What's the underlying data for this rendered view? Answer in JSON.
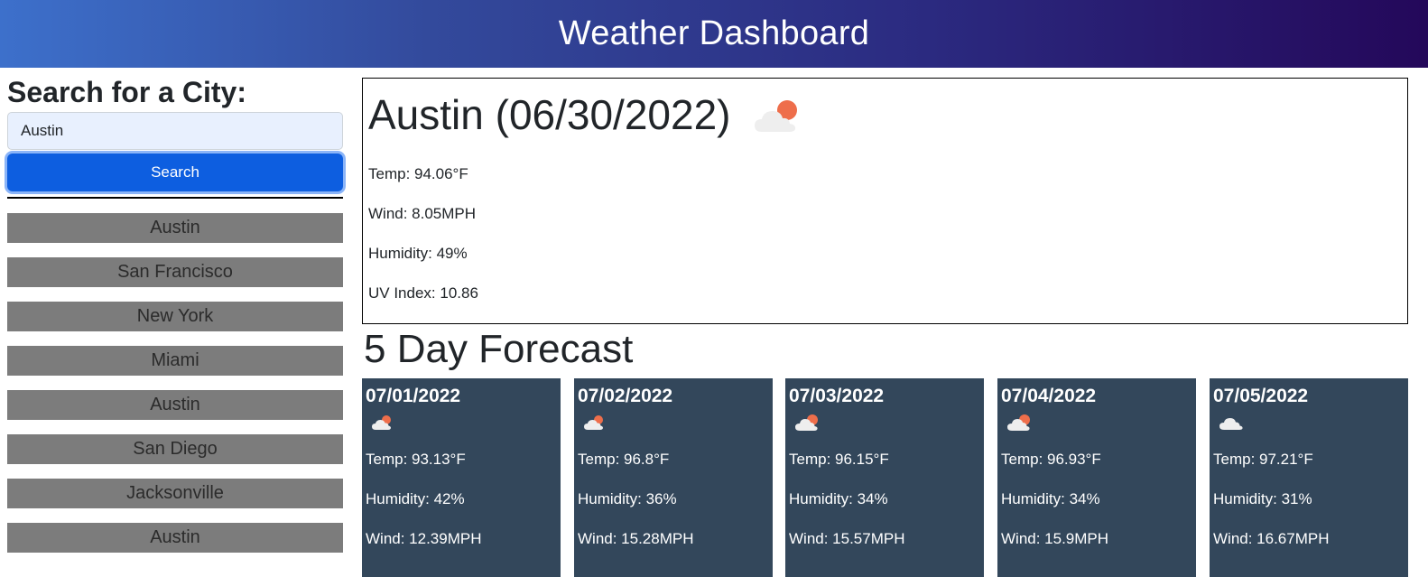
{
  "header": {
    "title": "Weather Dashboard"
  },
  "search": {
    "title": "Search for a City:",
    "input_value": "Austin",
    "button_label": "Search"
  },
  "history": [
    "Austin",
    "San Francisco",
    "New York",
    "Miami",
    "Austin",
    "San Diego",
    "Jacksonville",
    "Austin"
  ],
  "current": {
    "title": "Austin (06/30/2022)",
    "icon": "partly-cloudy-sun-icon",
    "temp": "Temp: 94.06°F",
    "wind": "Wind: 8.05MPH",
    "humidity": "Humidity: 49%",
    "uv": "UV Index: 10.86"
  },
  "forecast": {
    "title": "5 Day Forecast",
    "days": [
      {
        "date": "07/01/2022",
        "icon": "partly-cloudy-sun-icon",
        "temp": "Temp: 93.13°F",
        "humidity": "Humidity: 42%",
        "wind": "Wind: 12.39MPH"
      },
      {
        "date": "07/02/2022",
        "icon": "partly-cloudy-sun-icon",
        "temp": "Temp: 96.8°F",
        "humidity": "Humidity: 36%",
        "wind": "Wind: 15.28MPH"
      },
      {
        "date": "07/03/2022",
        "icon": "partly-cloudy-sun-icon",
        "temp": "Temp: 96.15°F",
        "humidity": "Humidity: 34%",
        "wind": "Wind: 15.57MPH"
      },
      {
        "date": "07/04/2022",
        "icon": "partly-cloudy-sun-icon",
        "temp": "Temp: 96.93°F",
        "humidity": "Humidity: 34%",
        "wind": "Wind: 15.9MPH"
      },
      {
        "date": "07/05/2022",
        "icon": "cloud-icon",
        "temp": "Temp: 97.21°F",
        "humidity": "Humidity: 31%",
        "wind": "Wind: 16.67MPH"
      }
    ]
  },
  "colors": {
    "header_gradient_start": "#3d70cb",
    "header_gradient_end": "#24085a",
    "search_button": "#0d5ee0",
    "history_button": "#7c7c7c",
    "forecast_card": "#33475b"
  }
}
